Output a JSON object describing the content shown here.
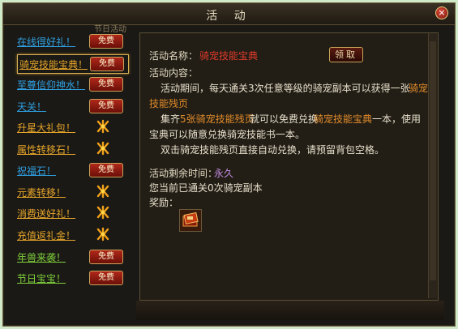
{
  "window": {
    "title": "活 动",
    "close_label": "×",
    "tab_hint": "节日活动"
  },
  "activities": [
    {
      "label": "在线得好礼！",
      "color": "blue",
      "action": "fee",
      "selected": false
    },
    {
      "label": "骑宠技能宝典！",
      "color": "gold",
      "action": "fee",
      "selected": true
    },
    {
      "label": "至尊信仰神水！",
      "color": "blue",
      "action": "fee",
      "selected": false
    },
    {
      "label": "天关！",
      "color": "blue",
      "action": "fee",
      "selected": false
    },
    {
      "label": "升星大礼包！",
      "color": "gold",
      "action": "claw",
      "selected": false
    },
    {
      "label": "属性转移石！",
      "color": "gold",
      "action": "claw",
      "selected": false
    },
    {
      "label": "祝福石！",
      "color": "blue",
      "action": "fee",
      "selected": false
    },
    {
      "label": "元素转移！",
      "color": "gold",
      "action": "claw",
      "selected": false
    },
    {
      "label": "消费送好礼！",
      "color": "gold",
      "action": "claw",
      "selected": false
    },
    {
      "label": "充值返礼金！",
      "color": "gold",
      "action": "claw",
      "selected": false
    },
    {
      "label": "年兽来袭！",
      "color": "green",
      "action": "fee",
      "selected": false
    },
    {
      "label": "节日宝宝！",
      "color": "green",
      "action": "fee",
      "selected": false
    }
  ],
  "fee_label": "免费",
  "detail": {
    "name_label": "活动名称：",
    "name_value": "骑宠技能宝典",
    "claim_button": "领取",
    "content_label": "活动内容：",
    "para1_a": "活动期间，每天通关3次任意等级的骑宠副本可以获得一张",
    "para1_b": "骑宠",
    "para1_c": "技能残页",
    "para2_a": "集齐",
    "para2_b": "5张骑宠技能残页",
    "para2_c": "就可以免费兑换",
    "para2_d": "骑宠技能宝典",
    "para2_e": "一本，使用",
    "para2_f": "宝典可以随意兑换骑宠技能书一本。",
    "para3": "双击骑宠技能残页直接自动兑换，请预留背包空格。",
    "remaining_label": "活动剩余时间：",
    "remaining_value": "永久",
    "progress_text": "您当前已通关0次骑宠副本",
    "reward_label": "奖励："
  }
}
